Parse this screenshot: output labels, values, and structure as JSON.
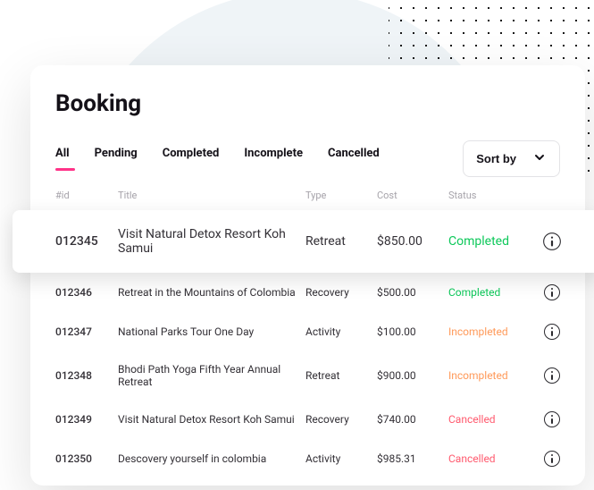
{
  "page_title": "Booking",
  "tabs": {
    "all": "All",
    "pending": "Pending",
    "completed": "Completed",
    "incomplete": "Incomplete",
    "cancelled": "Cancelled"
  },
  "active_tab": "all",
  "sort_button_label": "Sort by",
  "columns": {
    "id": "#id",
    "title": "Title",
    "type": "Type",
    "cost": "Cost",
    "status": "Status"
  },
  "rows": [
    {
      "id": "012345",
      "title": "Visit Natural Detox Resort Koh Samui",
      "type": "Retreat",
      "cost": "$850.00",
      "status": "Completed",
      "highlighted": true
    },
    {
      "id": "012346",
      "title": "Retreat in the Mountains of Colombia",
      "type": "Recovery",
      "cost": "$500.00",
      "status": "Completed"
    },
    {
      "id": "012347",
      "title": "National Parks Tour One Day",
      "type": "Activity",
      "cost": "$100.00",
      "status": "Incompleted"
    },
    {
      "id": "012348",
      "title": "Bhodi Path Yoga Fifth Year Annual Retreat",
      "type": "Retreat",
      "cost": "$900.00",
      "status": "Incompleted"
    },
    {
      "id": "012349",
      "title": "Visit Natural Detox Resort Koh Samui",
      "type": "Recovery",
      "cost": "$740.00",
      "status": "Cancelled"
    },
    {
      "id": "012350",
      "title": "Descovery yourself in colombia",
      "type": "Activity",
      "cost": "$985.31",
      "status": "Cancelled"
    }
  ]
}
